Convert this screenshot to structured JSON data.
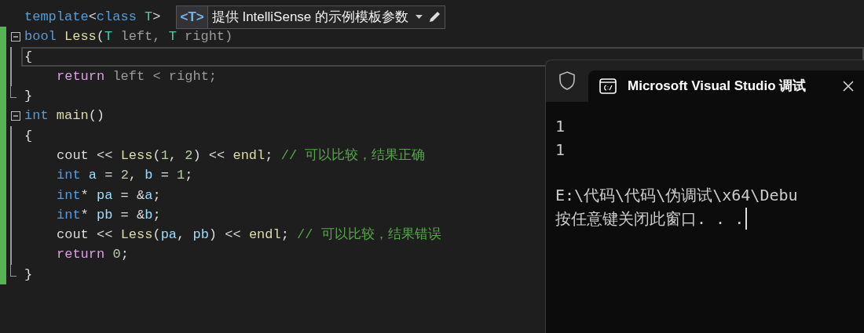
{
  "editor": {
    "hint": {
      "tag": "<T>",
      "text": "提供 IntelliSense 的示例模板参数"
    },
    "lines": [
      {
        "kind": "plain",
        "indent": false,
        "modified": false,
        "current": false,
        "tokens": [
          {
            "text": "template",
            "kind": "keyword"
          },
          {
            "text": "<",
            "kind": "plain"
          },
          {
            "text": "class ",
            "kind": "keyword"
          },
          {
            "text": "T",
            "kind": "type"
          },
          {
            "text": ">",
            "kind": "plain"
          }
        ]
      },
      {
        "kind": "fold-start",
        "indent": false,
        "modified": true,
        "current": false,
        "tokens": [
          {
            "text": "bool ",
            "kind": "keyword"
          },
          {
            "text": "Less",
            "kind": "function"
          },
          {
            "text": "(",
            "kind": "plain"
          },
          {
            "text": "T",
            "kind": "type"
          },
          {
            "text": " left, ",
            "kind": "param"
          },
          {
            "text": "T",
            "kind": "type"
          },
          {
            "text": " right)",
            "kind": "param"
          }
        ]
      },
      {
        "kind": "fold-body",
        "indent": false,
        "modified": true,
        "current": true,
        "tokens": [
          {
            "text": "{",
            "kind": "plain"
          }
        ]
      },
      {
        "kind": "fold-body",
        "indent": true,
        "modified": true,
        "current": false,
        "tokens": [
          {
            "text": "return",
            "kind": "control"
          },
          {
            "text": " left < right;",
            "kind": "param"
          }
        ]
      },
      {
        "kind": "fold-end",
        "indent": false,
        "modified": true,
        "current": false,
        "tokens": [
          {
            "text": "}",
            "kind": "plain"
          }
        ]
      },
      {
        "kind": "fold-start",
        "indent": false,
        "modified": true,
        "current": false,
        "tokens": [
          {
            "text": "int ",
            "kind": "keyword"
          },
          {
            "text": "main",
            "kind": "function"
          },
          {
            "text": "()",
            "kind": "plain"
          }
        ]
      },
      {
        "kind": "fold-body",
        "indent": false,
        "modified": true,
        "current": false,
        "tokens": [
          {
            "text": "{",
            "kind": "plain"
          }
        ]
      },
      {
        "kind": "fold-body",
        "indent": true,
        "modified": true,
        "current": false,
        "tokens": [
          {
            "text": "cout << ",
            "kind": "plain"
          },
          {
            "text": "Less",
            "kind": "function"
          },
          {
            "text": "(",
            "kind": "plain"
          },
          {
            "text": "1",
            "kind": "number"
          },
          {
            "text": ", ",
            "kind": "plain"
          },
          {
            "text": "2",
            "kind": "number"
          },
          {
            "text": ") << ",
            "kind": "plain"
          },
          {
            "text": "endl",
            "kind": "function"
          },
          {
            "text": "; ",
            "kind": "plain"
          },
          {
            "text": "// 可以比较，结果正确",
            "kind": "comment"
          }
        ]
      },
      {
        "kind": "fold-body",
        "indent": true,
        "modified": true,
        "current": false,
        "tokens": [
          {
            "text": "int ",
            "kind": "keyword"
          },
          {
            "text": "a",
            "kind": "variable"
          },
          {
            "text": " = ",
            "kind": "plain"
          },
          {
            "text": "2",
            "kind": "number"
          },
          {
            "text": ", ",
            "kind": "plain"
          },
          {
            "text": "b",
            "kind": "variable"
          },
          {
            "text": " = ",
            "kind": "plain"
          },
          {
            "text": "1",
            "kind": "number"
          },
          {
            "text": ";",
            "kind": "plain"
          }
        ]
      },
      {
        "kind": "fold-body",
        "indent": true,
        "modified": true,
        "current": false,
        "tokens": [
          {
            "text": "int",
            "kind": "keyword"
          },
          {
            "text": "* ",
            "kind": "plain"
          },
          {
            "text": "pa",
            "kind": "variable"
          },
          {
            "text": " = &",
            "kind": "plain"
          },
          {
            "text": "a",
            "kind": "variable"
          },
          {
            "text": ";",
            "kind": "plain"
          }
        ]
      },
      {
        "kind": "fold-body",
        "indent": true,
        "modified": true,
        "current": false,
        "tokens": [
          {
            "text": "int",
            "kind": "keyword"
          },
          {
            "text": "* ",
            "kind": "plain"
          },
          {
            "text": "pb",
            "kind": "variable"
          },
          {
            "text": " = &",
            "kind": "plain"
          },
          {
            "text": "b",
            "kind": "variable"
          },
          {
            "text": ";",
            "kind": "plain"
          }
        ]
      },
      {
        "kind": "fold-body",
        "indent": true,
        "modified": true,
        "current": false,
        "tokens": [
          {
            "text": "cout << ",
            "kind": "plain"
          },
          {
            "text": "Less",
            "kind": "function"
          },
          {
            "text": "(",
            "kind": "plain"
          },
          {
            "text": "pa",
            "kind": "variable"
          },
          {
            "text": ", ",
            "kind": "plain"
          },
          {
            "text": "pb",
            "kind": "variable"
          },
          {
            "text": ") << ",
            "kind": "plain"
          },
          {
            "text": "endl",
            "kind": "function"
          },
          {
            "text": "; ",
            "kind": "plain"
          },
          {
            "text": "// 可以比较，结果错误",
            "kind": "comment"
          }
        ]
      },
      {
        "kind": "fold-body",
        "indent": true,
        "modified": true,
        "current": false,
        "tokens": [
          {
            "text": "return ",
            "kind": "control"
          },
          {
            "text": "0",
            "kind": "number"
          },
          {
            "text": ";",
            "kind": "plain"
          }
        ]
      },
      {
        "kind": "fold-end",
        "indent": false,
        "modified": true,
        "current": false,
        "tokens": [
          {
            "text": "}",
            "kind": "plain"
          }
        ]
      }
    ]
  },
  "console": {
    "title": "Microsoft Visual Studio 调试",
    "output": [
      [
        "1",
        "1"
      ],
      [
        "E:\\代码\\代码\\伪调试\\x64\\Debu",
        "按任意键关闭此窗口. . ."
      ]
    ]
  }
}
